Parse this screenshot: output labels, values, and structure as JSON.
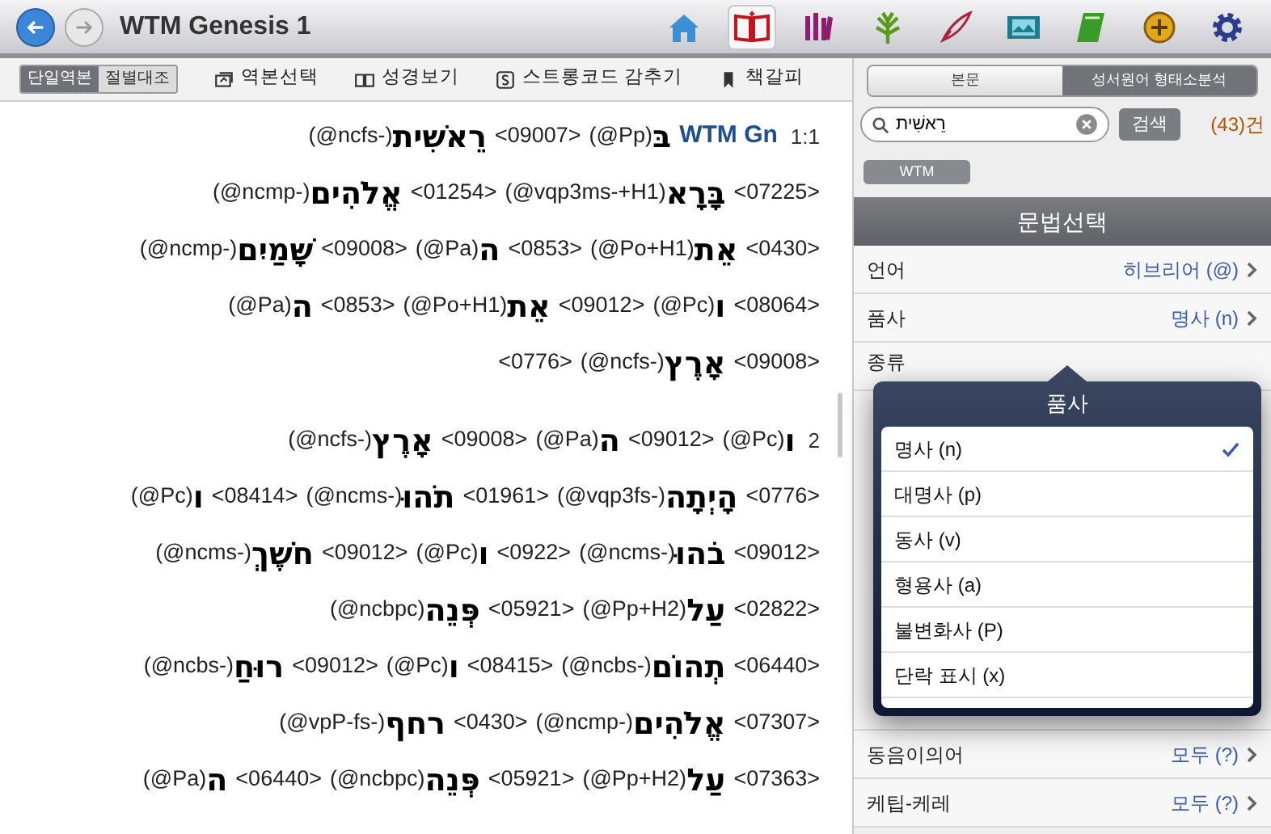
{
  "window": {
    "title": "WTM Genesis 1"
  },
  "nav": {
    "back_enabled": true,
    "forward_enabled": false
  },
  "toolbar_icons": [
    {
      "kind": "home",
      "selected": false
    },
    {
      "kind": "bible",
      "selected": true
    },
    {
      "kind": "library",
      "selected": false
    },
    {
      "kind": "tree",
      "selected": false
    },
    {
      "kind": "quill",
      "selected": false
    },
    {
      "kind": "media",
      "selected": false
    },
    {
      "kind": "note",
      "selected": false
    },
    {
      "kind": "emblem",
      "selected": false
    },
    {
      "kind": "settings",
      "selected": false
    }
  ],
  "view_toggle": [
    {
      "label": "단일역본",
      "selected": true
    },
    {
      "label": "절별대조",
      "selected": false
    }
  ],
  "tools": [
    {
      "kind": "translation",
      "label": "역본선택"
    },
    {
      "kind": "bible",
      "label": "성경보기"
    },
    {
      "kind": "strong",
      "label": "스트롱코드 감추기"
    },
    {
      "kind": "bookmark",
      "label": "책갈피"
    }
  ],
  "verses": [
    {
      "number": "1:1",
      "lines": [
        [
          {
            "kind": "code",
            "text": "(@ncfs-)"
          },
          {
            "kind": "heb",
            "text": "רֵאשִׁית"
          },
          {
            "kind": "strong",
            "text": "<09007>"
          },
          {
            "kind": "code",
            "text": "(@Pp)"
          },
          {
            "kind": "heb",
            "text": "בּ"
          },
          {
            "kind": "ref",
            "text": "WTM Gn"
          }
        ],
        [
          {
            "kind": "code",
            "text": "(@ncmp-)"
          },
          {
            "kind": "heb",
            "text": "אֱלֹהִים"
          },
          {
            "kind": "strong",
            "text": "<01254>"
          },
          {
            "kind": "code",
            "text": "(@vqp3ms-+H1)"
          },
          {
            "kind": "heb",
            "text": "בָּרָא"
          },
          {
            "kind": "strong",
            "text": "<07225>"
          }
        ],
        [
          {
            "kind": "code",
            "text": "(@ncmp-)"
          },
          {
            "kind": "heb",
            "text": "שָּׁמַיִם"
          },
          {
            "kind": "strong",
            "text": "<09008>"
          },
          {
            "kind": "code",
            "text": "(@Pa)"
          },
          {
            "kind": "heb",
            "text": "ה"
          },
          {
            "kind": "strong",
            "text": "<0853>"
          },
          {
            "kind": "code",
            "text": "(@Po+H1)"
          },
          {
            "kind": "heb",
            "text": "אֵת"
          },
          {
            "kind": "strong",
            "text": "<0430>"
          }
        ],
        [
          {
            "kind": "code",
            "text": "(@Pa)"
          },
          {
            "kind": "heb",
            "text": "ה"
          },
          {
            "kind": "strong",
            "text": "<0853>"
          },
          {
            "kind": "code",
            "text": "(@Po+H1)"
          },
          {
            "kind": "heb",
            "text": "אֵת"
          },
          {
            "kind": "strong",
            "text": "<09012>"
          },
          {
            "kind": "code",
            "text": "(@Pc)"
          },
          {
            "kind": "heb",
            "text": "ו"
          },
          {
            "kind": "strong",
            "text": "<08064>"
          }
        ],
        [
          {
            "kind": "strong",
            "text": "<0776>"
          },
          {
            "kind": "code",
            "text": "(@ncfs-)"
          },
          {
            "kind": "heb",
            "text": "אָרֶץ"
          },
          {
            "kind": "strong",
            "text": "<09008>"
          }
        ]
      ]
    },
    {
      "number": "2",
      "lines": [
        [
          {
            "kind": "code",
            "text": "(@ncfs-)"
          },
          {
            "kind": "heb",
            "text": "אָרֶץ"
          },
          {
            "kind": "strong",
            "text": "<09008>"
          },
          {
            "kind": "code",
            "text": "(@Pa)"
          },
          {
            "kind": "heb",
            "text": "ה"
          },
          {
            "kind": "strong",
            "text": "<09012>"
          },
          {
            "kind": "code",
            "text": "(@Pc)"
          },
          {
            "kind": "heb",
            "text": "ו"
          }
        ],
        [
          {
            "kind": "code",
            "text": "(@Pc)"
          },
          {
            "kind": "heb",
            "text": "ו"
          },
          {
            "kind": "strong",
            "text": "<08414>"
          },
          {
            "kind": "code",
            "text": "(@ncms-)"
          },
          {
            "kind": "heb",
            "text": "תֹהוּ"
          },
          {
            "kind": "strong",
            "text": "<01961>"
          },
          {
            "kind": "code",
            "text": "(@vqp3fs-)"
          },
          {
            "kind": "heb",
            "text": "הָיְתָה"
          },
          {
            "kind": "strong",
            "text": "<0776>"
          }
        ],
        [
          {
            "kind": "code",
            "text": "(@ncms-)"
          },
          {
            "kind": "heb",
            "text": "חֹשֶׁךְ"
          },
          {
            "kind": "strong",
            "text": "<09012>"
          },
          {
            "kind": "code",
            "text": "(@Pc)"
          },
          {
            "kind": "heb",
            "text": "ו"
          },
          {
            "kind": "strong",
            "text": "<0922>"
          },
          {
            "kind": "code",
            "text": "(@ncms-)"
          },
          {
            "kind": "heb",
            "text": "בֹהוּ"
          },
          {
            "kind": "strong",
            "text": "<09012>"
          }
        ],
        [
          {
            "kind": "code",
            "text": "(@ncbpc)"
          },
          {
            "kind": "heb",
            "text": "פְּנֵה"
          },
          {
            "kind": "strong",
            "text": "<05921>"
          },
          {
            "kind": "code",
            "text": "(@Pp+H2)"
          },
          {
            "kind": "heb",
            "text": "עַל"
          },
          {
            "kind": "strong",
            "text": "<02822>"
          }
        ],
        [
          {
            "kind": "code",
            "text": "(@ncbs-)"
          },
          {
            "kind": "heb",
            "text": "רוּחַ"
          },
          {
            "kind": "strong",
            "text": "<09012>"
          },
          {
            "kind": "code",
            "text": "(@Pc)"
          },
          {
            "kind": "heb",
            "text": "ו"
          },
          {
            "kind": "strong",
            "text": "<08415>"
          },
          {
            "kind": "code",
            "text": "(@ncbs-)"
          },
          {
            "kind": "heb",
            "text": "תְהוֹם"
          },
          {
            "kind": "strong",
            "text": "<06440>"
          }
        ],
        [
          {
            "kind": "code",
            "text": "(@vpP-fs-)"
          },
          {
            "kind": "heb",
            "text": "רחף"
          },
          {
            "kind": "strong",
            "text": "<0430>"
          },
          {
            "kind": "code",
            "text": "(@ncmp-)"
          },
          {
            "kind": "heb",
            "text": "אֱלֹהִים"
          },
          {
            "kind": "strong",
            "text": "<07307>"
          }
        ],
        [
          {
            "kind": "code",
            "text": "(@Pa)"
          },
          {
            "kind": "heb",
            "text": "ה"
          },
          {
            "kind": "strong",
            "text": "<06440>"
          },
          {
            "kind": "code",
            "text": "(@ncbpc)"
          },
          {
            "kind": "heb",
            "text": "פְּנֵה"
          },
          {
            "kind": "strong",
            "text": "<05921>"
          },
          {
            "kind": "code",
            "text": "(@Pp+H2)"
          },
          {
            "kind": "heb",
            "text": "עַל"
          },
          {
            "kind": "strong",
            "text": "<07363>"
          }
        ]
      ]
    }
  ],
  "right_tabs": [
    {
      "label": "본문",
      "selected": false
    },
    {
      "label": "성서원어 형태소분석",
      "selected": true
    }
  ],
  "search": {
    "value": "רֵאשִׁית",
    "button": "검색",
    "count": "(43)건"
  },
  "version_button": "WTM",
  "grammar": {
    "title": "문법선택",
    "top_rows": [
      {
        "label": "언어",
        "value": "히브리어 (@)"
      },
      {
        "label": "품사",
        "value": "명사 (n)"
      },
      {
        "label": "종류"
      }
    ],
    "bottom_rows": [
      {
        "label": "동음이의어",
        "value": "모두 (?)"
      },
      {
        "label": "케팁-케레",
        "value": "모두 (?)"
      }
    ]
  },
  "popup": {
    "title": "품사",
    "options": [
      {
        "label": "명사 (n)",
        "selected": true
      },
      {
        "label": "대명사 (p)",
        "selected": false
      },
      {
        "label": "동사 (v)",
        "selected": false
      },
      {
        "label": "형용사 (a)",
        "selected": false
      },
      {
        "label": "불변화사 (P)",
        "selected": false
      },
      {
        "label": "단락 표시 (x)",
        "selected": false
      }
    ]
  }
}
